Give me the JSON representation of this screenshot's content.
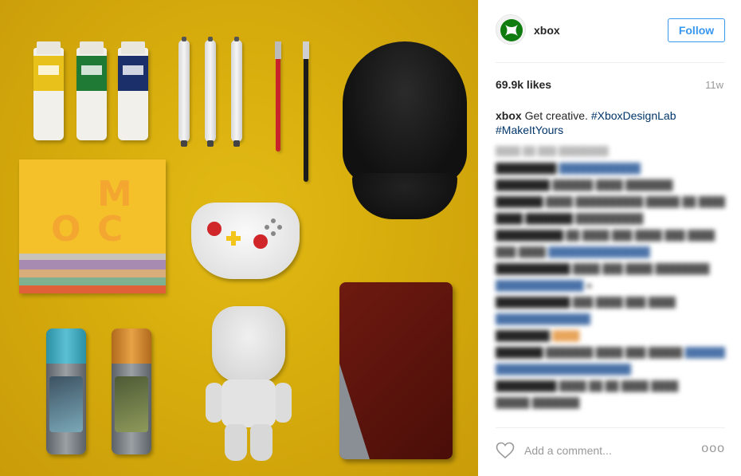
{
  "post": {
    "username": "xbox",
    "follow_label": "Follow",
    "likes": "69.9k likes",
    "timestamp": "11w",
    "caption": {
      "username": "xbox",
      "text": " Get creative. ",
      "hashtag1": "#XboxDesignLab",
      "hashtag2": "#MakeItYours"
    },
    "add_comment_placeholder": "Add a comment...",
    "more_options": "ooo"
  },
  "colors": {
    "accent_blue": "#3897f0",
    "xbox_green": "#107c10",
    "photo_background": "#dcb012"
  },
  "icons": {
    "avatar": "xbox-logo-icon",
    "like": "heart-icon",
    "options": "more-options-icon"
  }
}
